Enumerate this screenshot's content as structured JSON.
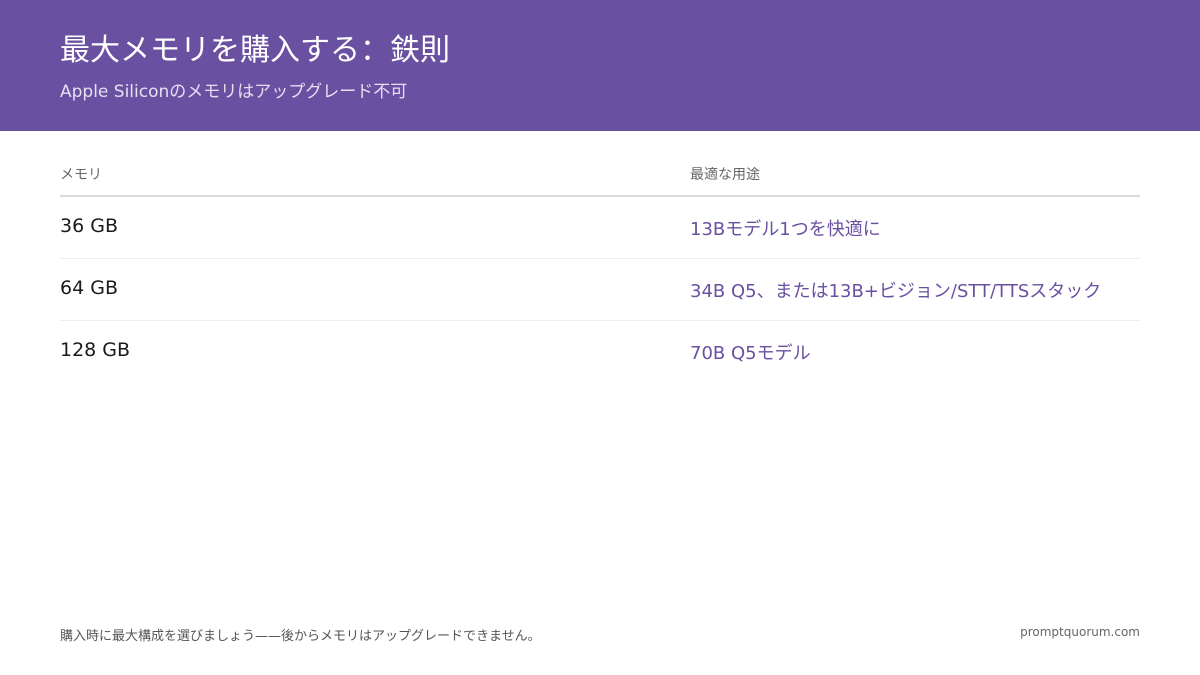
{
  "header": {
    "title": "最大メモリを購入する：鉄則",
    "subtitle": "Apple Siliconのメモリはアップグレード不可"
  },
  "table": {
    "columns": [
      "メモリ",
      "最適な用途"
    ],
    "rows": [
      {
        "memory": "36 GB",
        "use": "13Bモデル1つを快適に"
      },
      {
        "memory": "64 GB",
        "use": "34B Q5、または13B+ビジョン/STT/TTSスタック"
      },
      {
        "memory": "128 GB",
        "use": "70B Q5モデル"
      }
    ]
  },
  "footer": {
    "note": "購入時に最大構成を選びましょう——後からメモリはアップグレードできません。",
    "site": "promptquorum.com"
  },
  "colors": {
    "header_bg": "#6950a1",
    "accent_text": "#6950a1"
  }
}
